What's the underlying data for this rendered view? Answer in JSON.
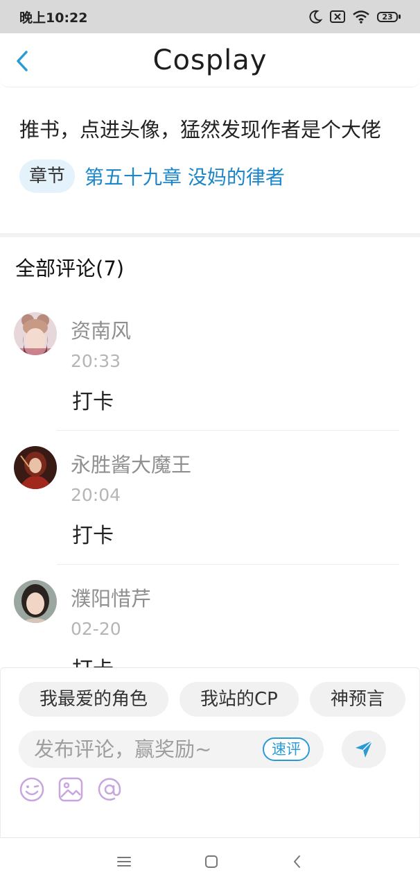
{
  "status_bar": {
    "time": "晚上10:22",
    "battery": "23",
    "icons": [
      "moon-icon",
      "notification-blocked-icon",
      "wifi-icon",
      "battery-icon"
    ]
  },
  "header": {
    "title": "Cosplay",
    "back_icon": "chevron-left-icon"
  },
  "post": {
    "text": "推书，点进头像，猛然发现作者是个大佬",
    "chapter_tag": "章节",
    "chapter_link": "第五十九章 没妈的律者"
  },
  "comments": {
    "title": "全部评论(7)",
    "items": [
      {
        "name": "资南风",
        "time": "20:33",
        "text": "打卡"
      },
      {
        "name": "永胜酱大魔王",
        "time": "20:04",
        "text": "打卡"
      },
      {
        "name": "濮阳惜芹",
        "time": "02-20",
        "text": "打卡"
      }
    ]
  },
  "composer": {
    "chips": [
      "我最爱的角色",
      "我站的CP",
      "神预言"
    ],
    "placeholder": "发布评论，赢奖励~",
    "quick_label": "速评",
    "send_icon": "send-icon",
    "tools": [
      "emoji-icon",
      "image-icon",
      "mention-icon"
    ]
  },
  "nav": {
    "icons": [
      "menu-icon",
      "home-icon",
      "back-icon"
    ]
  },
  "colors": {
    "accent": "#1b86c9",
    "tool_icon": "#c7a6e0",
    "tag_bg": "#e4f2fb"
  }
}
